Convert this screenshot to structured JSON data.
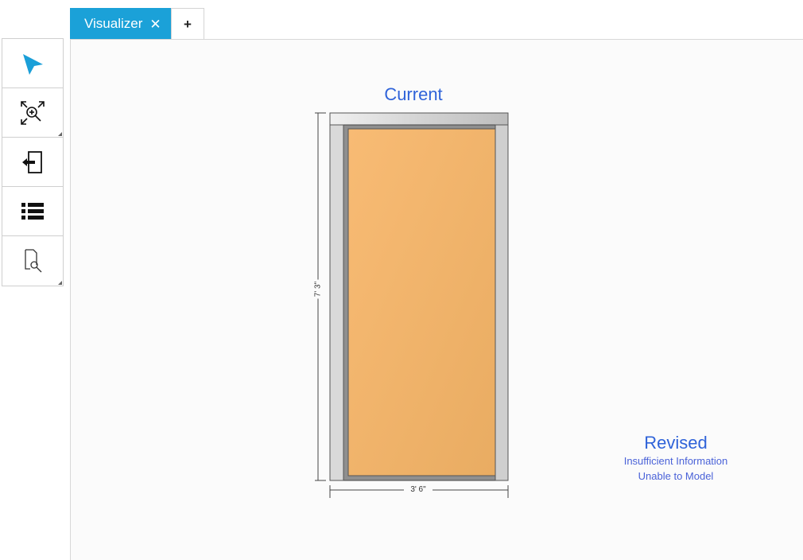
{
  "tabs": {
    "active_label": "Visualizer",
    "close_glyph": "✕",
    "add_glyph": "+"
  },
  "toolbar": [
    {
      "name": "select-tool",
      "icon": "pointer-arrow-icon"
    },
    {
      "name": "zoom-extents-tool",
      "icon": "zoom-expand-icon"
    },
    {
      "name": "insert-tool",
      "icon": "insert-door-icon"
    },
    {
      "name": "list-tool",
      "icon": "list-icon"
    },
    {
      "name": "inspect-tool",
      "icon": "document-search-icon"
    }
  ],
  "visualizer": {
    "current_label": "Current",
    "height_dimension": "7' 3\"",
    "width_dimension": "3' 6\"",
    "revised_label": "Revised",
    "revised_message_line1": "Insufficient Information",
    "revised_message_line2": "Unable to Model"
  },
  "colors": {
    "accent": "#1ba1d8",
    "label_blue": "#2f63d9",
    "door_fill": "#f6b872",
    "frame_gray": "#d7d7d7"
  }
}
